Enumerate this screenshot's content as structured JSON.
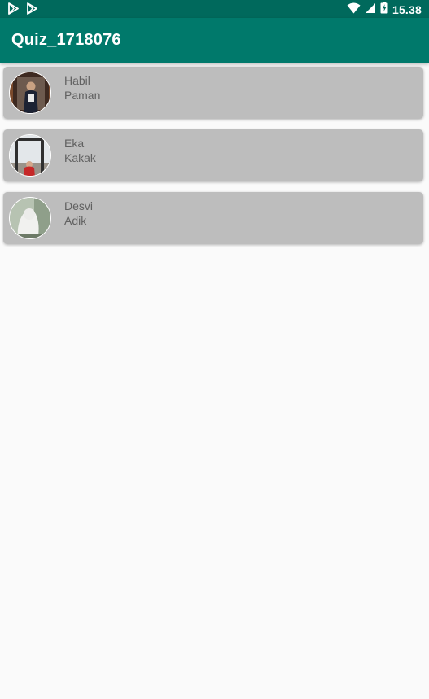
{
  "status_bar": {
    "time": "15.38",
    "left_icons": [
      "play-store-icon",
      "play-store-icon"
    ],
    "right_icons": [
      "wifi-icon",
      "signal-icon",
      "battery-charging-icon"
    ]
  },
  "app_bar": {
    "title": "Quiz_1718076"
  },
  "contacts": [
    {
      "name": "Habil",
      "relation": "Paman"
    },
    {
      "name": "Eka",
      "relation": "Kakak"
    },
    {
      "name": "Desvi",
      "relation": "Adik"
    }
  ],
  "colors": {
    "status_bar": "#00695c",
    "app_bar": "#00796b",
    "card_background": "#bdbdbd",
    "page_background": "#fafafa",
    "text_secondary": "#616161"
  }
}
